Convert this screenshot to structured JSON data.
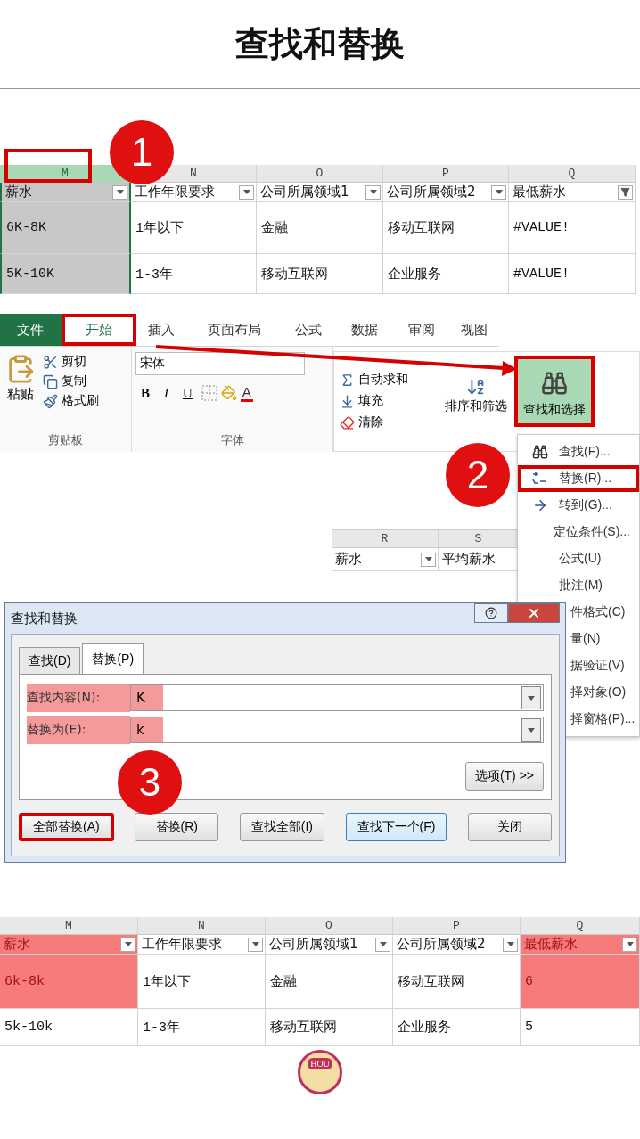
{
  "title": "查找和替换",
  "sheet_before": {
    "step": "1",
    "columns": [
      {
        "letter": "M",
        "selected": true,
        "boxed": true,
        "filtered": false,
        "marked": false
      },
      {
        "letter": "N",
        "selected": false,
        "boxed": false,
        "filtered": false,
        "marked": false
      },
      {
        "letter": "O",
        "selected": false,
        "boxed": false,
        "filtered": false,
        "marked": false
      },
      {
        "letter": "P",
        "selected": false,
        "boxed": false,
        "filtered": false,
        "marked": false
      },
      {
        "letter": "Q",
        "selected": false,
        "boxed": false,
        "filtered": true,
        "marked": false
      }
    ],
    "headers": [
      "薪水",
      "工作年限要求",
      "公司所属领域1",
      "公司所属领域2",
      "最低薪水"
    ],
    "rows": [
      [
        "6K-8K",
        "1年以下",
        "金融",
        "移动互联网",
        "#VALUE!"
      ],
      [
        "5K-10K",
        "1-3年",
        "移动互联网",
        "企业服务",
        "#VALUE!"
      ]
    ]
  },
  "ribbon": {
    "step": "2",
    "file_tab": "文件",
    "tabs": [
      {
        "label": "开始",
        "selected": true
      },
      {
        "label": "插入",
        "selected": false
      },
      {
        "label": "页面布局",
        "selected": false
      },
      {
        "label": "公式",
        "selected": false
      },
      {
        "label": "数据",
        "selected": false
      },
      {
        "label": "审阅",
        "selected": false
      },
      {
        "label": "视图",
        "selected": false
      }
    ],
    "clipboard": {
      "paste": "粘贴",
      "label": "剪贴板",
      "actions": [
        {
          "label": "剪切",
          "kind": "cut"
        },
        {
          "label": "复制",
          "kind": "copy"
        },
        {
          "label": "格式刷",
          "kind": "painter"
        }
      ]
    },
    "font": {
      "name": "宋体",
      "styles": [
        "B",
        "I",
        "U"
      ],
      "color_letter": "A",
      "label": "字体"
    },
    "editing": {
      "actions": [
        {
          "label": "自动求和",
          "kind": "sum"
        },
        {
          "label": "填充",
          "kind": "fill"
        },
        {
          "label": "清除",
          "kind": "clear"
        }
      ],
      "sort": "排序和筛选",
      "find": {
        "label": "查找和选择",
        "active": true
      }
    }
  },
  "sheet_fragment": {
    "columns": [
      "R",
      "S"
    ],
    "headers": [
      "薪水",
      "平均薪水"
    ]
  },
  "menu": {
    "items": [
      {
        "label": "查找(F)...",
        "kind": "find",
        "selected": false
      },
      {
        "label": "替换(R)...",
        "kind": "replace",
        "selected": true
      },
      {
        "label": "转到(G)...",
        "kind": "goto",
        "selected": false
      },
      {
        "label": "定位条件(S)...",
        "kind": "plain",
        "selected": false
      },
      {
        "label": "公式(U)",
        "kind": "plain",
        "selected": false
      },
      {
        "label": "批注(M)",
        "kind": "plain",
        "selected": false
      },
      {
        "label": "件格式(C)",
        "kind": "clipped",
        "selected": false
      },
      {
        "label": "量(N)",
        "kind": "clipped",
        "selected": false
      },
      {
        "label": "据验证(V)",
        "kind": "clipped",
        "selected": false
      },
      {
        "label": "择对象(O)",
        "kind": "clipped",
        "selected": false
      },
      {
        "label": "择窗格(P)...",
        "kind": "clipped",
        "selected": false
      }
    ]
  },
  "dialog": {
    "step": "3",
    "title": "查找和替换",
    "tabs": [
      {
        "label": "查找(D)",
        "selected": false
      },
      {
        "label": "替换(P)",
        "selected": true
      }
    ],
    "fields": [
      {
        "label": "查找内容(N):",
        "value": "K",
        "marked": true
      },
      {
        "label": "替换为(E):",
        "value": "k",
        "marked": true
      }
    ],
    "options": "选项(T) >>",
    "buttons": [
      {
        "label": "全部替换(A)",
        "boxed": true,
        "default": false
      },
      {
        "label": "替换(R)",
        "boxed": false,
        "default": false
      },
      {
        "label": "查找全部(I)",
        "boxed": false,
        "default": false
      },
      {
        "label": "查找下一个(F)",
        "boxed": false,
        "default": true
      },
      {
        "label": "关闭",
        "boxed": false,
        "default": false
      }
    ]
  },
  "sheet_after": {
    "columns": [
      {
        "letter": "M",
        "selected": false,
        "filtered": false,
        "marked": true
      },
      {
        "letter": "N",
        "selected": false,
        "filtered": false,
        "marked": false
      },
      {
        "letter": "O",
        "selected": false,
        "filtered": false,
        "marked": false
      },
      {
        "letter": "P",
        "selected": false,
        "filtered": false,
        "marked": false
      },
      {
        "letter": "Q",
        "selected": false,
        "filtered": false,
        "marked": true
      }
    ],
    "headers": [
      "薪水",
      "工作年限要求",
      "公司所属领域1",
      "公司所属领域2",
      "最低薪水"
    ],
    "rows": [
      [
        "6k-8k",
        "1年以下",
        "金融",
        "移动互联网",
        "6"
      ],
      [
        "5k-10k",
        "1-3年",
        "移动互联网",
        "企业服务",
        "5"
      ]
    ]
  },
  "logo": "HOU"
}
